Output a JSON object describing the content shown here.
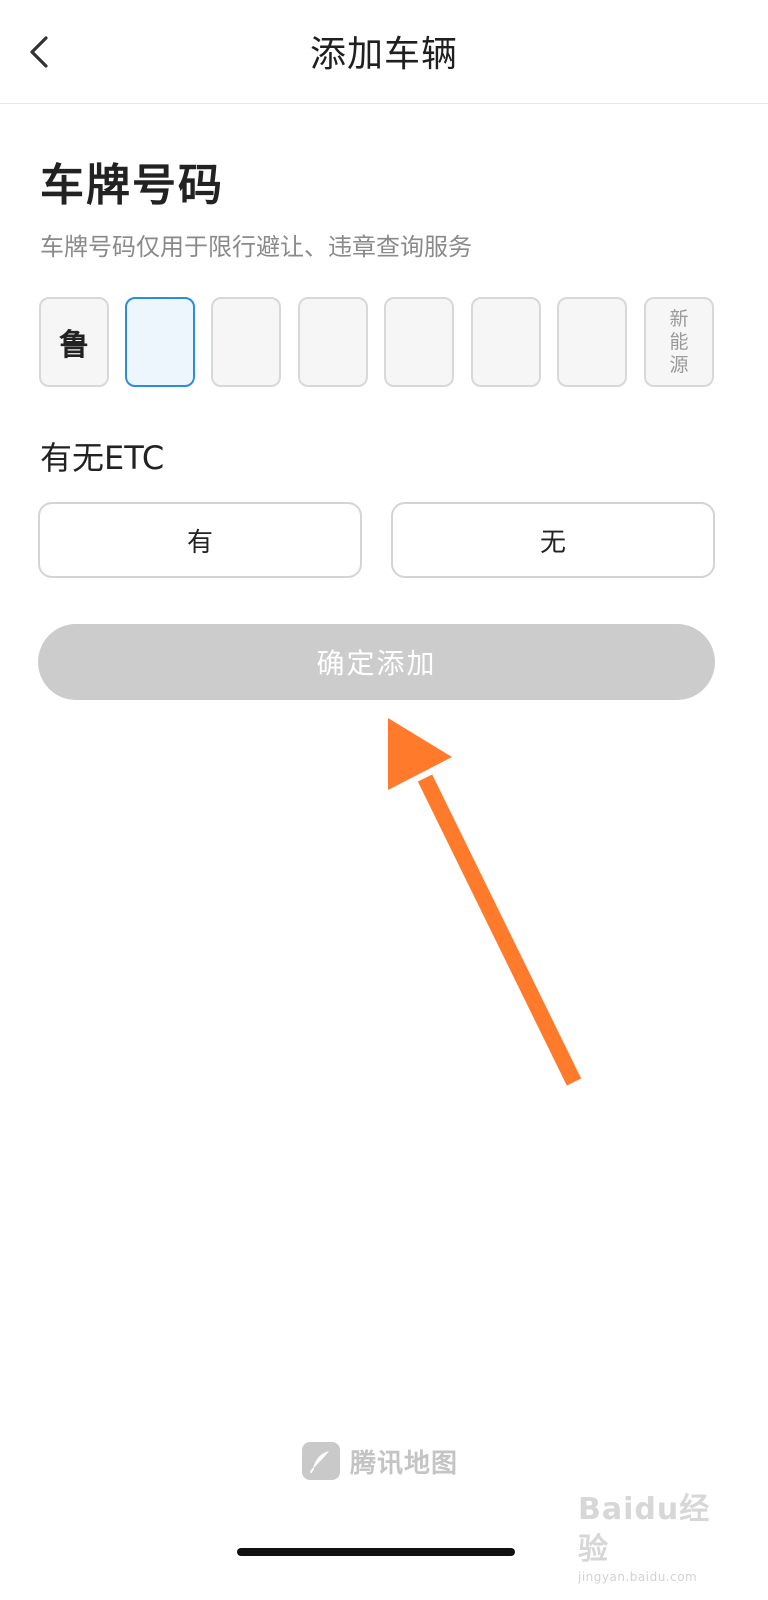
{
  "header": {
    "title": "添加车辆",
    "back_icon": "chevron-left-icon"
  },
  "plate": {
    "title": "车牌号码",
    "subtitle": "车牌号码仅用于限行避让、违章查询服务",
    "province": "鲁",
    "new_energy": [
      "新",
      "能",
      "源"
    ]
  },
  "etc": {
    "title": "有无ETC",
    "yes_label": "有",
    "no_label": "无"
  },
  "confirm": {
    "label": "确定添加"
  },
  "brand": {
    "name": "腾讯地图",
    "logo_icon": "tencent-map-logo-icon"
  },
  "watermark": {
    "main": "Baidu经验",
    "sub": "jingyan.baidu.com"
  },
  "colors": {
    "active_border": "#2b8ce8",
    "confirm_disabled": "#cccccc",
    "arrow": "#ff7a2a"
  }
}
